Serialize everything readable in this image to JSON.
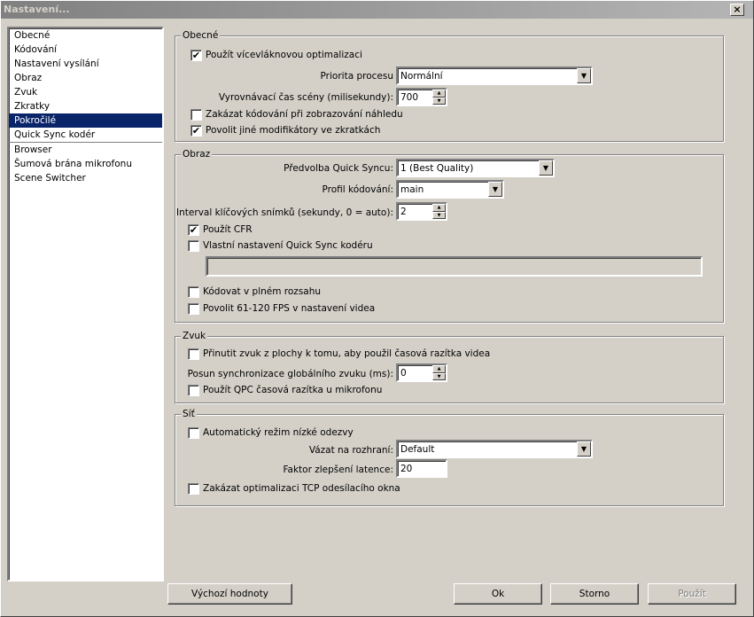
{
  "window": {
    "title": "Nastavení...",
    "close": "×"
  },
  "sidebar": {
    "items": [
      {
        "label": "Obecné"
      },
      {
        "label": "Kódování"
      },
      {
        "label": "Nastavení vysílání"
      },
      {
        "label": "Obraz"
      },
      {
        "label": "Zvuk"
      },
      {
        "label": "Zkratky"
      },
      {
        "label": "Pokročilé",
        "selected": true
      },
      {
        "label": "Quick Sync kodér"
      },
      {
        "label": "Browser"
      },
      {
        "label": "Šumová brána mikrofonu"
      },
      {
        "label": "Scene Switcher"
      }
    ]
  },
  "general": {
    "title": "Obecné",
    "multithread": "Použít vícevláknovou optimalizaci",
    "multithread_checked": true,
    "priority_label": "Priorita procesu",
    "priority_value": "Normální",
    "buffer_label": "Vyrovnávací čas scény (milisekundy):",
    "buffer_value": "700",
    "disable_preview_enc": "Zakázat kódování při zobrazování náhledu",
    "allow_modifiers": "Povolit jiné modifikátory ve zkratkách",
    "allow_modifiers_checked": true
  },
  "video": {
    "title": "Obraz",
    "preset_label": "Předvolba Quick Syncu:",
    "preset_value": "1 (Best Quality)",
    "profile_label": "Profil kódování:",
    "profile_value": "main",
    "keyint_label": "Interval klíčových snímků (sekundy, 0 = auto):",
    "keyint_value": "2",
    "cfr": "Použít CFR",
    "cfr_checked": true,
    "custom": "Vlastní nastavení Quick Sync kodéru",
    "custom_value": "",
    "fullrange": "Kódovat v plném rozsahu",
    "highfps": "Povolit 61-120 FPS v nastavení videa"
  },
  "audio": {
    "title": "Zvuk",
    "force_ts": "Přinutit zvuk z plochy k tomu, aby použil časová razítka videa",
    "offset_label": "Posun synchronizace globálního zvuku  (ms):",
    "offset_value": "0",
    "qpc": "Použít QPC časová razítka u mikrofonu"
  },
  "network": {
    "title": "Síť",
    "lowlat": "Automatický režim nízké odezvy",
    "bind_label": "Vázat na rozhraní:",
    "bind_value": "Default",
    "latency_label": "Faktor zlepšení latence:",
    "latency_value": "20",
    "tcp": "Zakázat optimalizaci TCP odesílacího okna"
  },
  "buttons": {
    "defaults": "Výchozí hodnoty",
    "ok": "Ok",
    "cancel": "Storno",
    "apply": "Použít"
  },
  "icons": {
    "check": "✔",
    "dropdown": "▼",
    "up": "▲",
    "down": "▼"
  }
}
